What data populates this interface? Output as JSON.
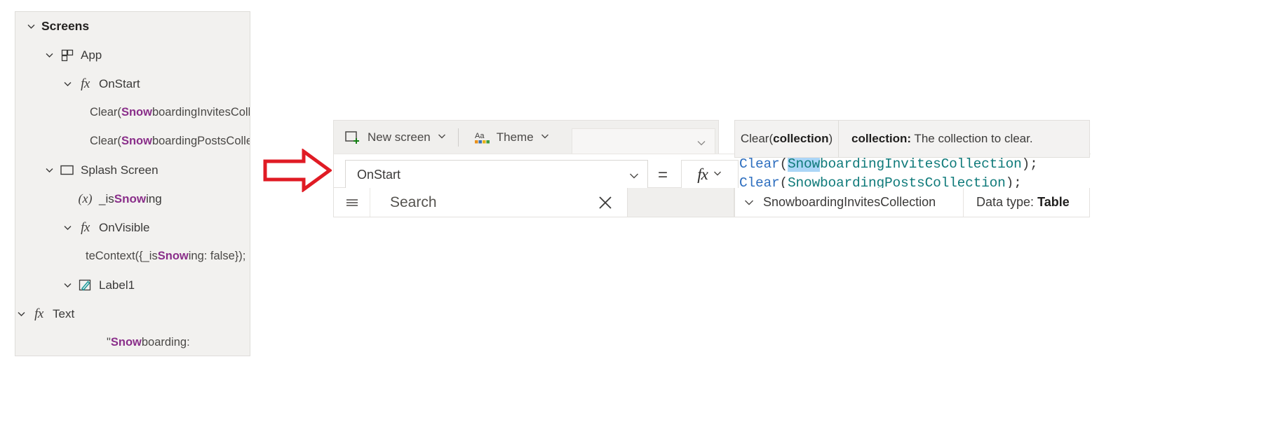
{
  "colors": {
    "search_highlight": "#8a2f8a",
    "code_function": "#2d6ebf",
    "code_identifier": "#0f7a7a",
    "code_selection": "#abd6f7",
    "arrow": "#e01b24",
    "panel_bg": "#f2f1ef"
  },
  "tree": {
    "root_label": "Screens",
    "items": [
      {
        "label": "Screens",
        "indent": 0,
        "chevron": "chevron-down",
        "icon": "none",
        "kind": "group"
      },
      {
        "label": "App",
        "indent": 1,
        "chevron": "chevron-down",
        "icon": "app-grid-icon",
        "kind": "node"
      },
      {
        "label": "OnStart",
        "indent": 2,
        "chevron": "chevron-down",
        "icon": "fx-icon",
        "kind": "node"
      },
      {
        "label_pre": "Clear(",
        "label_hl": "Snow",
        "label_post": "boardingInvitesColle...",
        "indent": 4,
        "chevron": "none",
        "icon": "none",
        "kind": "code"
      },
      {
        "label_pre": "Clear(",
        "label_hl": "Snow",
        "label_post": "boardingPostsCollec...",
        "indent": 4,
        "chevron": "none",
        "icon": "none",
        "kind": "code"
      },
      {
        "label": "Splash Screen",
        "indent": 1,
        "chevron": "chevron-down",
        "icon": "screen-icon",
        "kind": "node"
      },
      {
        "label_pre": "_is",
        "label_hl": "Snow",
        "label_post": "ing",
        "indent": 2,
        "chevron": "none",
        "icon": "variable-x-icon",
        "kind": "var"
      },
      {
        "label": "OnVisible",
        "indent": 2,
        "chevron": "chevron-down",
        "icon": "fx-icon",
        "kind": "node"
      },
      {
        "label_pre": "teContext({_is",
        "label_hl": "Snow",
        "label_post": "ing: false});",
        "indent": 3,
        "chevron": "none",
        "icon": "none",
        "kind": "code"
      },
      {
        "label": "Label1",
        "indent": 2,
        "chevron": "chevron-down",
        "icon": "label-edit-icon",
        "kind": "node"
      },
      {
        "label": "Text",
        "indent": 3,
        "chevron": "chevron-down",
        "icon": "fx-icon",
        "kind": "node"
      },
      {
        "label_pre": "\"",
        "label_hl": "Snow",
        "label_post": "boarding:",
        "indent": 4,
        "chevron": "none",
        "icon": "none",
        "kind": "code"
      }
    ]
  },
  "arrow": {
    "name": "red-right-arrow",
    "direction": "right"
  },
  "toolbar": {
    "new_screen_label": "New screen",
    "new_screen_icon": "new-screen-plus-icon",
    "theme_label": "Theme",
    "theme_icon": "theme-aa-icon",
    "chevron_icon": "chevron-down-icon"
  },
  "formula_bar": {
    "property_value": "OnStart",
    "equals": "=",
    "fx_label": "fx",
    "code_lines": [
      {
        "fn": "Clear",
        "open": "(",
        "sel": "Snow",
        "ident_rest": "boardingInvitesCollection",
        "close": ");"
      },
      {
        "fn": "Clear",
        "open": "(",
        "sel": "",
        "ident_rest": "SnowboardingPostsCollection",
        "close": ");"
      }
    ]
  },
  "tooltip": {
    "signature_pre": "Clear(",
    "signature_bold": "collection",
    "signature_post": ")",
    "description_bold": "collection:",
    "description_text": " The collection to clear."
  },
  "search": {
    "placeholder": "Search",
    "hamburger_icon": "hamburger-icon",
    "clear_icon": "close-icon"
  },
  "suggestion": {
    "chevron_icon": "chevron-down-icon",
    "name": "SnowboardingInvitesCollection",
    "type_label": "Data type:",
    "type_value": "Table"
  }
}
